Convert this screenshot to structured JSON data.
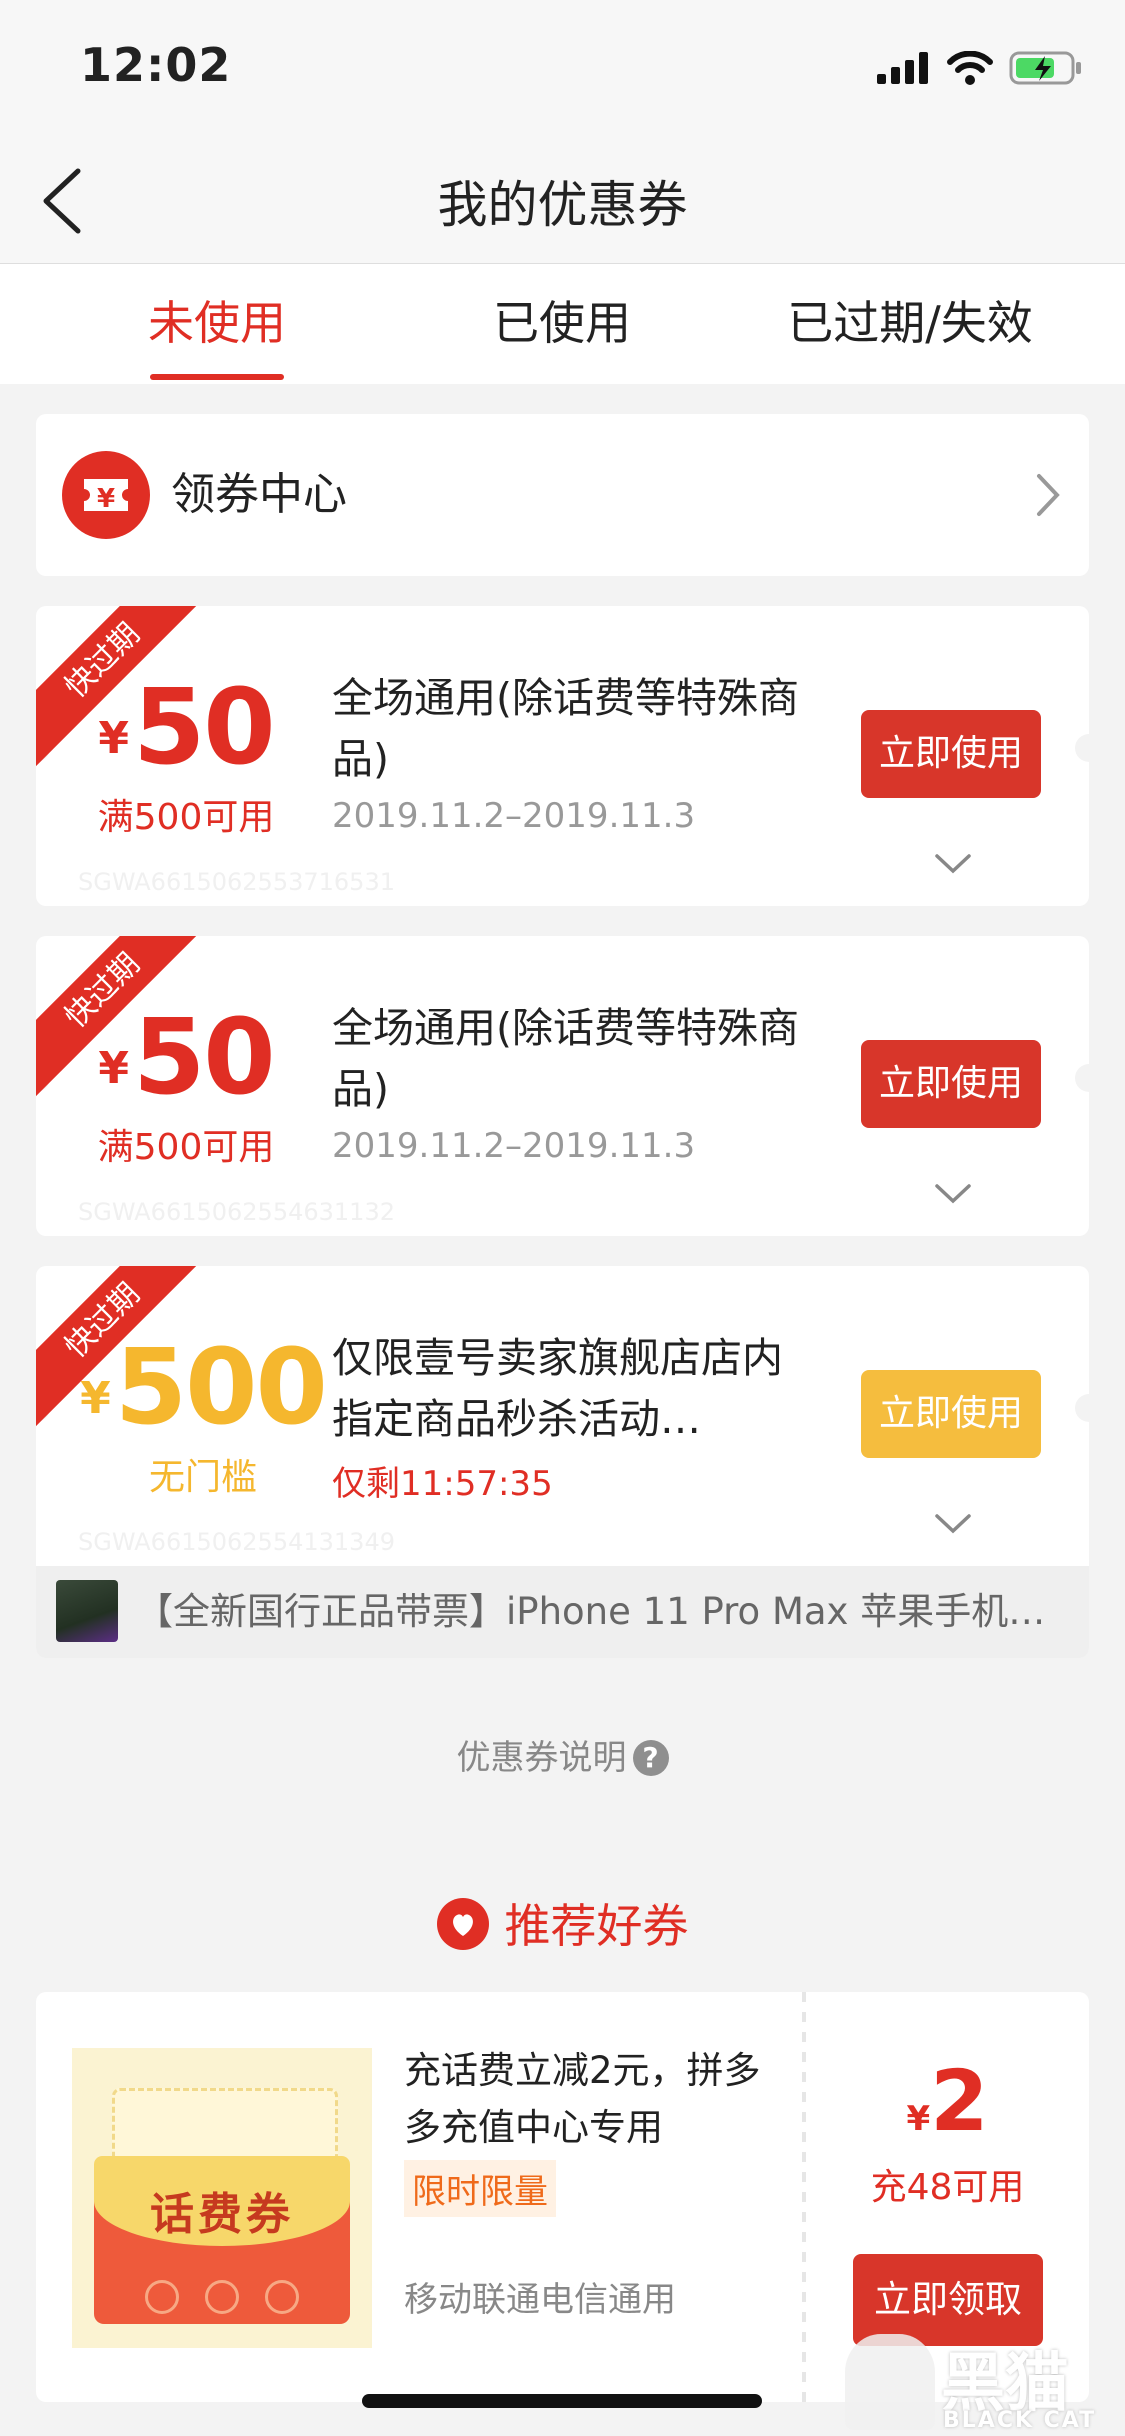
{
  "status_bar": {
    "time": "12:02"
  },
  "header": {
    "title": "我的优惠券"
  },
  "tabs": [
    {
      "label": "未使用",
      "active": true
    },
    {
      "label": "已使用",
      "active": false
    },
    {
      "label": "已过期/失效",
      "active": false
    }
  ],
  "coupon_center": {
    "label": "领券中心",
    "icon": "coupon-ticket-icon"
  },
  "coupons": [
    {
      "ribbon": "快过期",
      "currency": "¥",
      "amount": "50",
      "condition": "满500可用",
      "title": "全场通用(除话费等特殊商品)",
      "date": "2019.11.2–2019.11.3",
      "button": "立即使用",
      "id": "SGWA6615062553716531",
      "accent": "#e02e24"
    },
    {
      "ribbon": "快过期",
      "currency": "¥",
      "amount": "50",
      "condition": "满500可用",
      "title": "全场通用(除话费等特殊商品)",
      "date": "2019.11.2–2019.11.3",
      "button": "立即使用",
      "id": "SGWA6615062554631132",
      "accent": "#e02e24"
    },
    {
      "ribbon": "快过期",
      "currency": "¥",
      "amount": "500",
      "condition": "无门槛",
      "title": "仅限壹号卖家旗舰店店内指定商品秒杀活动…",
      "date": "仅剩11:57:35",
      "button": "立即使用",
      "id": "SGWA6615062554131349",
      "accent": "#f5b72e",
      "product": "【全新国行正品带票】iPhone 11 Pro Max 苹果手机…"
    }
  ],
  "explain": {
    "label": "优惠券说明",
    "icon": "?"
  },
  "recommend": {
    "title": "推荐好券",
    "card": {
      "image_text": "话费券",
      "desc": "充话费立减2元，拼多多充值中心专用",
      "badge": "限时限量",
      "note": "移动联通电信通用",
      "currency": "¥",
      "amount": "2",
      "condition": "充48可用",
      "button": "立即领取"
    }
  },
  "watermark": {
    "cn": "黑猫",
    "en": "BLACK CAT"
  },
  "colors": {
    "brand_red": "#e02e24",
    "button_red": "#d8362a",
    "yellow": "#f5b72e",
    "background": "#f3f3f3"
  }
}
